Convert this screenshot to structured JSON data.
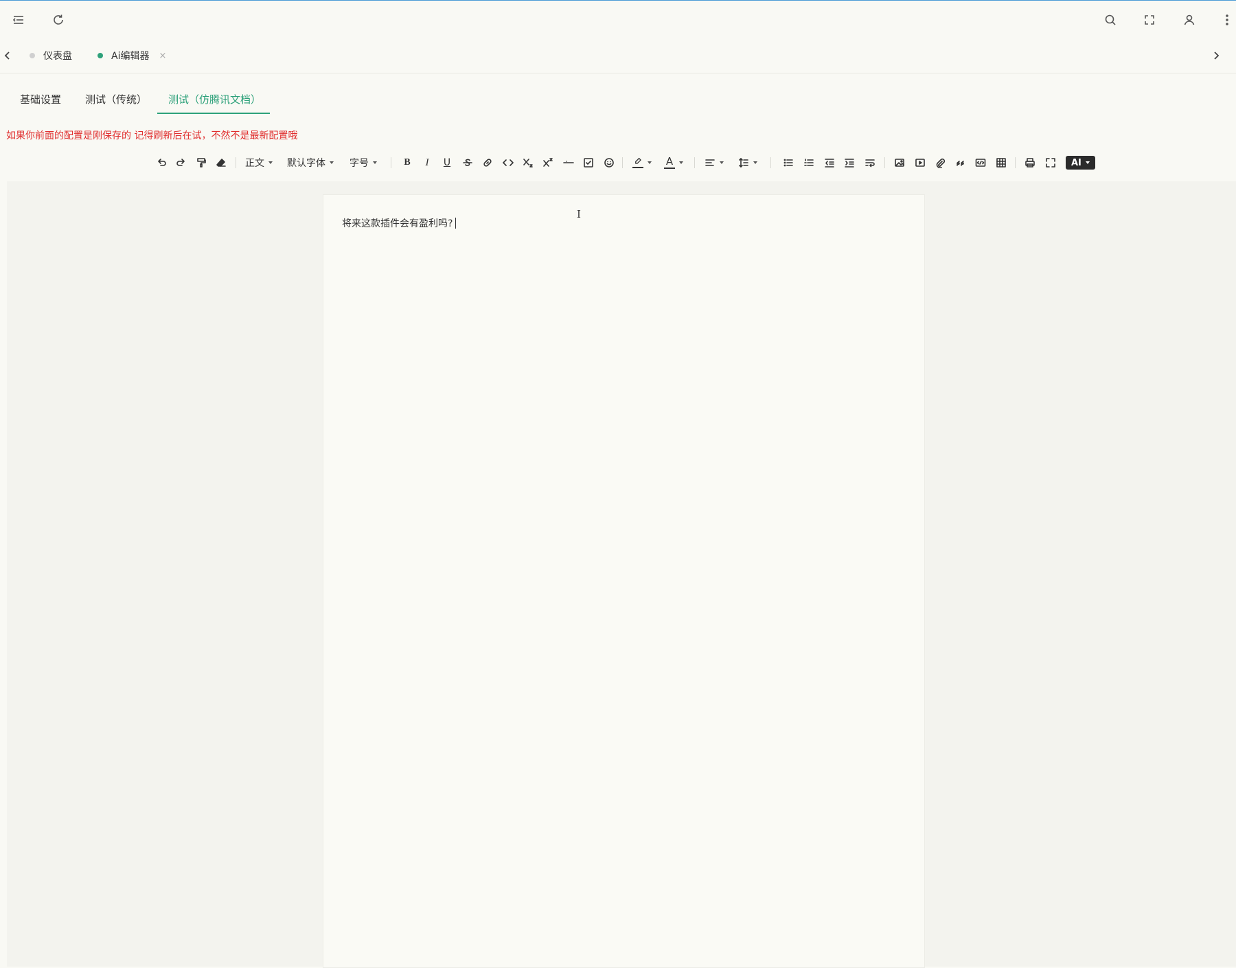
{
  "header": {
    "icons": [
      "menu-fold-icon",
      "refresh-icon",
      "search-icon",
      "fullscreen-icon",
      "user-icon",
      "more-icon"
    ]
  },
  "page_tabs": {
    "items": [
      {
        "label": "仪表盘",
        "dot_color": "#d0d0d0"
      },
      {
        "label": "Ai编辑器",
        "dot_color": "#2ea17a",
        "closable": true,
        "close_label": "×"
      }
    ]
  },
  "sub_tabs": {
    "items": [
      {
        "label": "基础设置"
      },
      {
        "label": "测试（传统）"
      },
      {
        "label": "测试（仿腾讯文档）",
        "active": true
      }
    ]
  },
  "notice": {
    "text": "如果你前面的配置是刚保存的 记得刷新后在试，不然不是最新配置哦",
    "color": "#e02d2d"
  },
  "toolbar": {
    "paragraph_label": "正文",
    "font_label": "默认字体",
    "size_label": "字号",
    "bold_label": "B",
    "italic_label": "I",
    "underline_label": "U",
    "font_color_label": "A",
    "ai_label": "AI"
  },
  "editor": {
    "content": "将来这款插件会有盈利吗?",
    "cursor_icon": "I"
  },
  "colors": {
    "accent": "#2ea17a",
    "warning": "#e02d2d",
    "background": "#f9f9f4"
  }
}
